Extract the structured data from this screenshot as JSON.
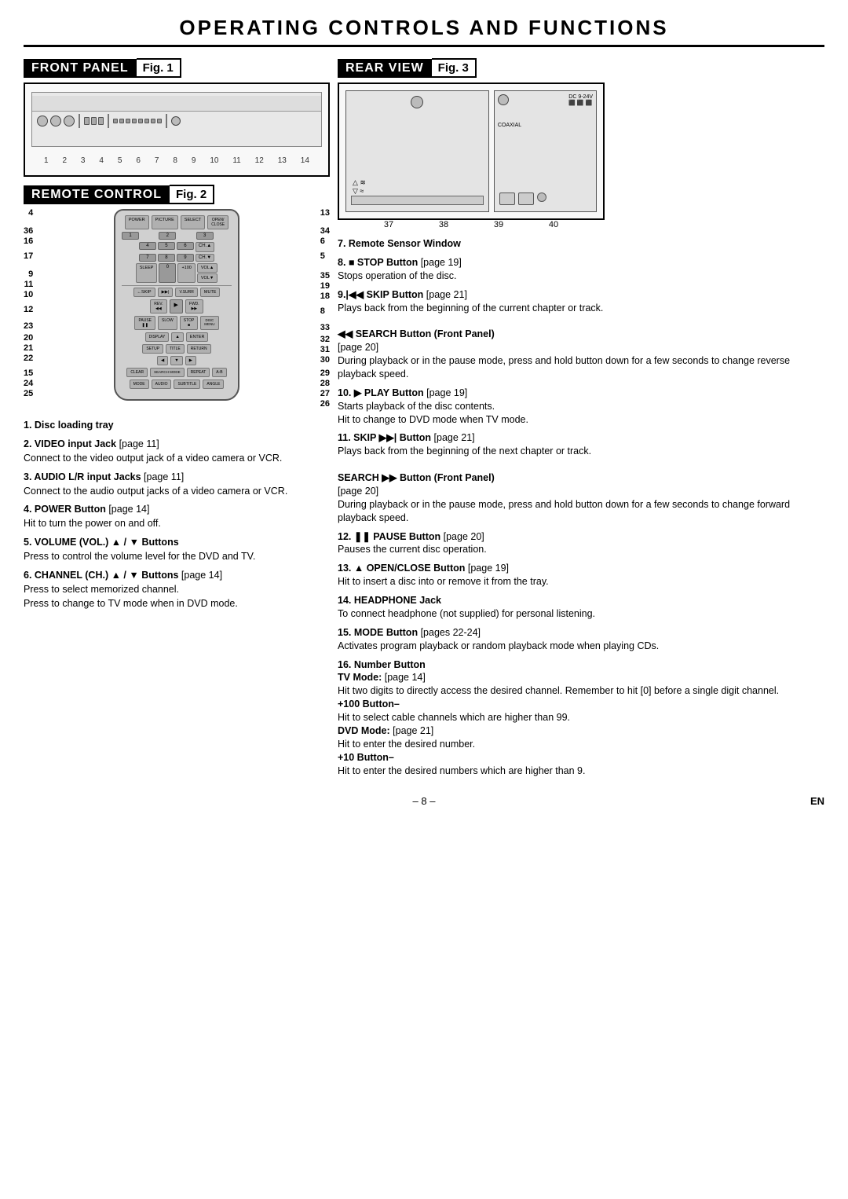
{
  "page": {
    "title": "OPERATING CONTROLS AND FUNCTIONS",
    "page_num": "– 8 –",
    "lang": "EN"
  },
  "front_panel": {
    "label": "FRONT PANEL",
    "fig": "Fig. 1",
    "numbers": [
      "1",
      "2",
      "3",
      "4",
      "5",
      "6",
      "7",
      "8",
      "9",
      "10",
      "11",
      "12",
      "13",
      "14"
    ]
  },
  "rear_view": {
    "label": "REAR VIEW",
    "fig": "Fig. 3",
    "numbers": [
      "37",
      "38",
      "39",
      "40"
    ]
  },
  "remote_control": {
    "label": "REMOTE CONTROL",
    "fig": "Fig. 2",
    "left_labels": [
      "4",
      "36",
      "16",
      "17",
      "9",
      "11",
      "10",
      "12",
      "23",
      "20",
      "21",
      "22",
      "15",
      "24",
      "25"
    ],
    "right_labels": [
      "13",
      "34",
      "6",
      "5",
      "35",
      "19",
      "18",
      "8",
      "33",
      "32",
      "31",
      "30",
      "29",
      "28",
      "27",
      "26"
    ],
    "buttons": {
      "top_row": [
        "POWER",
        "PICTURE",
        "SELECT",
        "OPEN/CLOSE"
      ],
      "num_row1": [
        "1",
        "2",
        "3",
        "CH.▲"
      ],
      "num_row2": [
        "4",
        "5",
        "6",
        "CH.▼"
      ],
      "num_row3": [
        "7",
        "8",
        "9",
        "VOL▲"
      ],
      "num_row4": [
        "SLEEP",
        "0",
        "+100",
        "VOL▼"
      ],
      "row_skip": [
        "←SKIP",
        "▶▶|",
        "V.SURR",
        "MUTE"
      ],
      "row_play": [
        "REV.◀◀",
        "PLAY▶",
        "FWD.▶▶"
      ],
      "row_stop": [
        "PAUSE",
        "SLOW",
        "STOP■",
        "DISC MENU"
      ],
      "row_nav": [
        "▲",
        "ENTER",
        "DISPLAY"
      ],
      "row_nav2": [
        "SETUP",
        "TITLE",
        "RETURN"
      ],
      "row_nav3": [
        "◀",
        "▼",
        "▶"
      ],
      "row_func": [
        "CLEAR",
        "SEARCH MODE",
        "REPEAT",
        "A-B"
      ],
      "row_mode": [
        "MODE",
        "AUDIO",
        "SUBTITLE",
        "ANGLE"
      ]
    }
  },
  "descriptions_left": [
    {
      "num": "1.",
      "title": "Disc loading tray",
      "text": ""
    },
    {
      "num": "2.",
      "title": "VIDEO input Jack",
      "ref": "[page 11]",
      "text": "Connect to the video output jack of a video camera or VCR."
    },
    {
      "num": "3.",
      "title": "AUDIO L/R input Jacks",
      "ref": "[page 11]",
      "text": "Connect to the audio output jacks of a video camera or VCR."
    },
    {
      "num": "4.",
      "title": "POWER Button",
      "ref": "[page 14]",
      "text": "Hit to turn the power on and off."
    },
    {
      "num": "5.",
      "title": "VOLUME (VOL.) ▲ / ▼ Buttons",
      "text": "Press to control the volume level for the DVD and TV."
    },
    {
      "num": "6.",
      "title": "CHANNEL (CH.) ▲ / ▼ Buttons",
      "ref": "[page 14]",
      "text": "Press to select memorized channel.\nPress to change to TV mode when in DVD mode."
    }
  ],
  "descriptions_right": [
    {
      "num": "7.",
      "title": "Remote Sensor Window",
      "text": ""
    },
    {
      "num": "8.",
      "icon": "■",
      "title": "STOP Button",
      "ref": "[page 19]",
      "text": "Stops operation of the disc."
    },
    {
      "num": "9.",
      "icon": "|◀◀",
      "title": "SKIP Button",
      "ref": "[page 21]",
      "text": "Plays back from the beginning of the current chapter or track.",
      "sub": {
        "icon": "◀◀",
        "title": "SEARCH Button (Front Panel)",
        "ref": "[page 20]",
        "text": "During playback or in the pause mode, press and hold button down for a few seconds to change reverse playback speed."
      }
    },
    {
      "num": "10.",
      "icon": "▶",
      "title": "PLAY Button",
      "ref": "[page 19]",
      "text": "Starts playback of the disc contents.\nHit to change to DVD mode when TV mode."
    },
    {
      "num": "11.",
      "title": "SKIP ▶▶| Button",
      "ref": "[page 21]",
      "text": "Plays back from the beginning of the next chapter or track.",
      "sub": {
        "icon": "▶▶",
        "title": "SEARCH ▶▶ Button (Front Panel)",
        "ref": "[page 20]",
        "text": "During playback or in the pause mode, press and hold button down for a few seconds to change forward playback speed."
      }
    },
    {
      "num": "12.",
      "icon": "❚❚",
      "title": "PAUSE Button",
      "ref": "[page 20]",
      "text": "Pauses the current disc operation."
    },
    {
      "num": "13.",
      "icon": "▲",
      "title": "OPEN/CLOSE Button",
      "ref": "[page 19]",
      "text": "Hit to insert a disc into or remove it from the tray."
    },
    {
      "num": "14.",
      "title": "HEADPHONE Jack",
      "text": "To connect headphone (not supplied) for personal listening."
    },
    {
      "num": "15.",
      "title": "MODE Button",
      "ref": "[pages 22-24]",
      "text": "Activates program playback or random playback mode when playing CDs."
    },
    {
      "num": "16.",
      "title": "Number Button",
      "subsections": [
        {
          "subtitle": "TV Mode:",
          "ref": "[page 14]",
          "text": "Hit two digits to directly access the desired channel. Remember to hit [0] before a single digit channel."
        },
        {
          "subtitle": "+100 Button–",
          "text": "Hit to select cable channels which are higher than 99."
        },
        {
          "subtitle": "DVD Mode:",
          "ref": "[page 21]",
          "text": "Hit to enter the desired number."
        },
        {
          "subtitle": "+10 Button–",
          "text": "Hit to enter the desired numbers which are higher than 9."
        }
      ]
    }
  ]
}
